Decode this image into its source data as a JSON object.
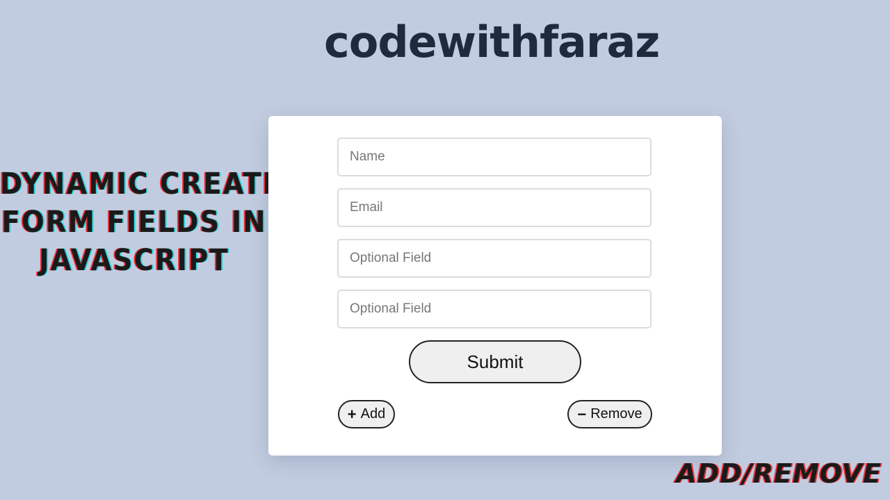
{
  "brand": "codewithfaraz",
  "headline": [
    "DYNAMIC CREATE",
    "FORM FIELDS IN",
    "JAVASCRIPT"
  ],
  "corner_tag": "ADD/REMOVE",
  "form": {
    "fields": [
      {
        "placeholder": "Name",
        "value": ""
      },
      {
        "placeholder": "Email",
        "value": ""
      },
      {
        "placeholder": "Optional Field",
        "value": ""
      },
      {
        "placeholder": "Optional Field",
        "value": ""
      }
    ],
    "submit_label": "Submit",
    "add_label": "Add",
    "remove_label": "Remove",
    "add_icon": "plus-icon",
    "remove_icon": "minus-icon"
  },
  "colors": {
    "background": "#c2cce0",
    "brand_text": "#1f2a3d",
    "card": "#ffffff",
    "glitch_red": "#e8333d",
    "glitch_cyan": "#2ed6df"
  }
}
